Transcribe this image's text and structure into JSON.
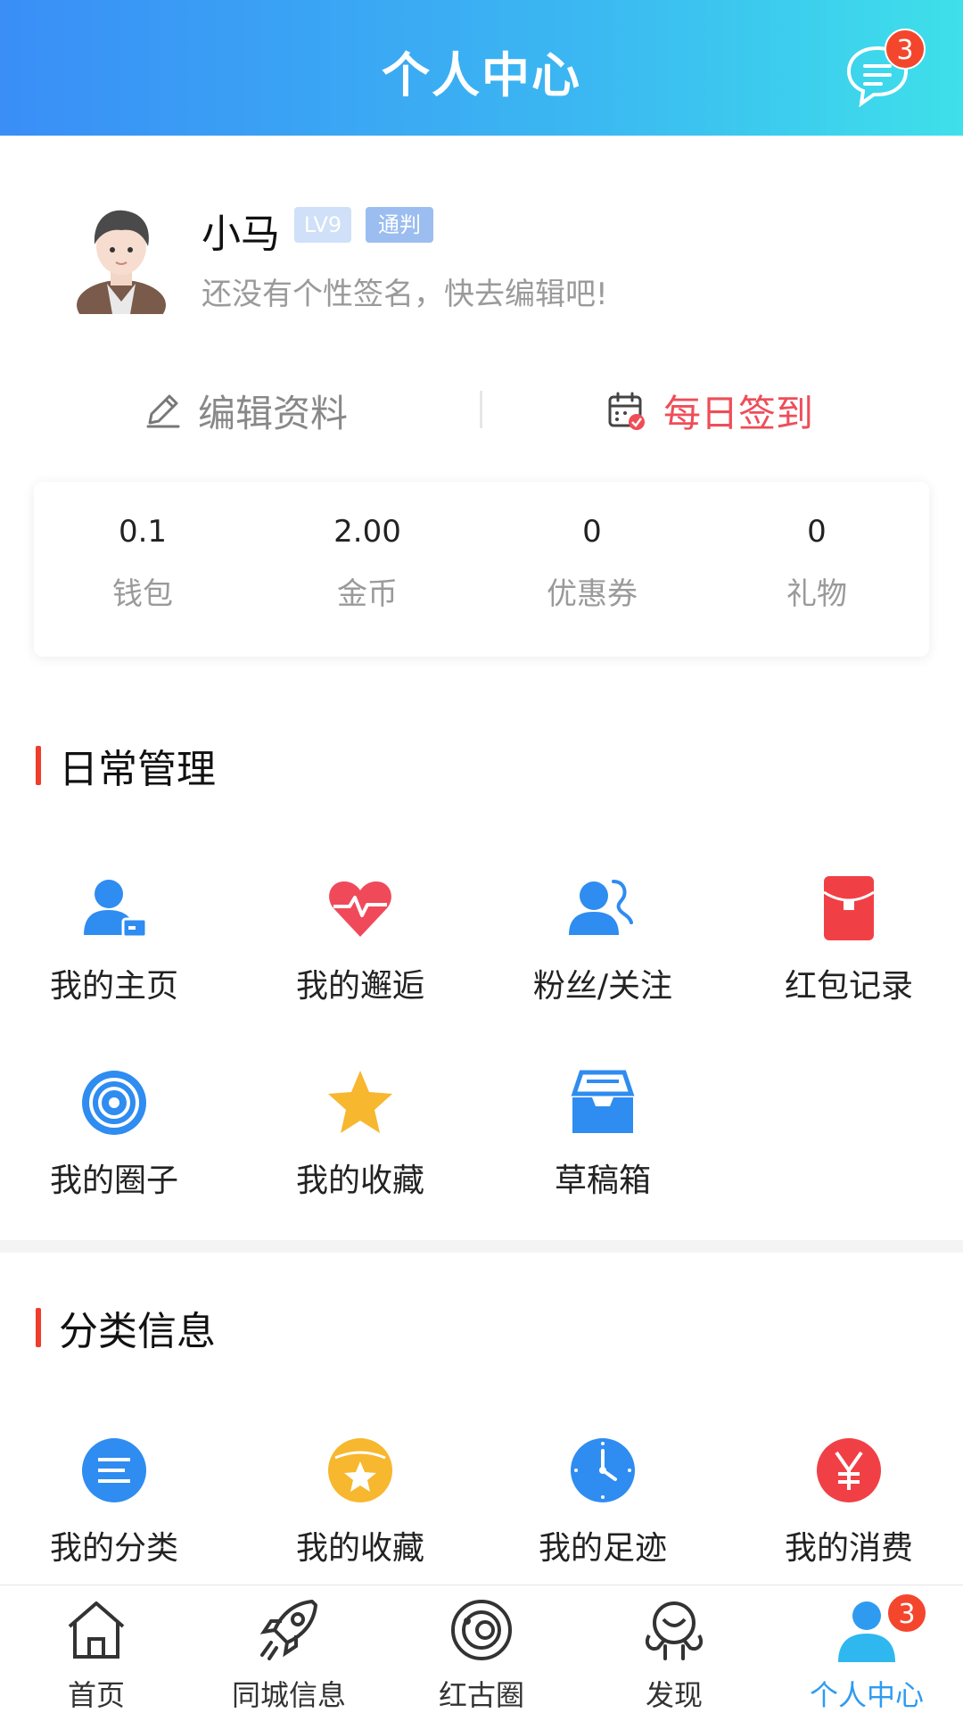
{
  "header": {
    "title": "个人中心",
    "message_badge": "3"
  },
  "profile": {
    "name": "小马",
    "level_tag": "LV9",
    "type_tag": "通判",
    "signature": "还没有个性签名，快去编辑吧!"
  },
  "actions": {
    "edit_label": "编辑资料",
    "sign_label": "每日签到"
  },
  "stats": [
    {
      "value": "0.1",
      "label": "钱包"
    },
    {
      "value": "2.00",
      "label": "金币"
    },
    {
      "value": "0",
      "label": "优惠券"
    },
    {
      "value": "0",
      "label": "礼物"
    }
  ],
  "daily": {
    "title": "日常管理",
    "items": [
      {
        "label": "我的主页",
        "icon": "user-card-icon"
      },
      {
        "label": "我的邂逅",
        "icon": "heart-pulse-icon"
      },
      {
        "label": "粉丝/关注",
        "icon": "users-icon"
      },
      {
        "label": "红包记录",
        "icon": "red-envelope-icon"
      },
      {
        "label": "我的圈子",
        "icon": "circle-target-icon"
      },
      {
        "label": "我的收藏",
        "icon": "star-icon"
      },
      {
        "label": "草稿箱",
        "icon": "inbox-tray-icon"
      }
    ]
  },
  "category": {
    "title": "分类信息",
    "items": [
      {
        "label": "我的分类",
        "icon": "list-icon"
      },
      {
        "label": "我的收藏",
        "icon": "star-badge-icon"
      },
      {
        "label": "我的足迹",
        "icon": "clock-icon"
      },
      {
        "label": "我的消费",
        "icon": "yen-icon"
      }
    ]
  },
  "tabbar": {
    "active": "个人中心",
    "profile_badge": "3",
    "items": [
      {
        "label": "首页",
        "icon": "home-icon"
      },
      {
        "label": "同城信息",
        "icon": "rocket-icon"
      },
      {
        "label": "红古圈",
        "icon": "orbit-icon"
      },
      {
        "label": "发现",
        "icon": "discover-icon"
      },
      {
        "label": "个人中心",
        "icon": "person-icon"
      }
    ]
  },
  "colors": {
    "header_gradient_start": "#3a8ef6",
    "header_gradient_end": "#3ee0ea",
    "accent_blue": "#2f9bf0",
    "accent_red": "#ef4d58",
    "badge_red": "#f4462c",
    "section_bar": "#f03c2c"
  }
}
